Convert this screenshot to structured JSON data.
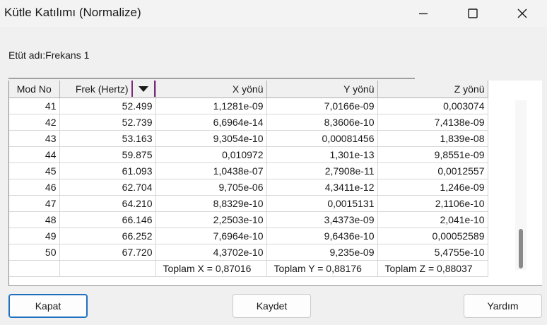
{
  "window": {
    "title": "Kütle Katılımı (Normalize)",
    "controls": [
      "minimize-icon",
      "maximize-icon",
      "close-icon"
    ]
  },
  "study_label": "Etüt adı:Frekans 1",
  "table": {
    "columns": [
      "Mod No",
      "Frek (Hertz)",
      "X yönü",
      "Y yönü",
      "Z yönü"
    ],
    "sort_icon": "sort-down-icon",
    "rows": [
      [
        "41",
        "52.499",
        "1,1281e-09",
        "7,0166e-09",
        "0,003074"
      ],
      [
        "42",
        "52.739",
        "6,6964e-14",
        "8,3606e-10",
        "7,4138e-09"
      ],
      [
        "43",
        "53.163",
        "9,3054e-10",
        "0,00081456",
        "1,839e-08"
      ],
      [
        "44",
        "59.875",
        "0,010972",
        "1,301e-13",
        "9,8551e-09"
      ],
      [
        "45",
        "61.093",
        "1,0438e-07",
        "2,7908e-11",
        "0,0012557"
      ],
      [
        "46",
        "62.704",
        "9,705e-06",
        "4,3411e-12",
        "1,246e-09"
      ],
      [
        "47",
        "64.210",
        "8,8329e-10",
        "0,0015131",
        "2,1106e-10"
      ],
      [
        "48",
        "66.146",
        "2,2503e-10",
        "3,4373e-09",
        "2,041e-10"
      ],
      [
        "49",
        "66.252",
        "7,6964e-10",
        "9,6436e-10",
        "0,00052589"
      ],
      [
        "50",
        "67.720",
        "4,3702e-10",
        "9,235e-09",
        "5,4755e-10"
      ]
    ],
    "totals": {
      "x": "Toplam X = 0,87016",
      "y": "Toplam Y = 0,88176",
      "z": "Toplam Z = 0,88037"
    }
  },
  "buttons": {
    "close": "Kapat",
    "save": "Kaydet",
    "help": "Yardım"
  }
}
